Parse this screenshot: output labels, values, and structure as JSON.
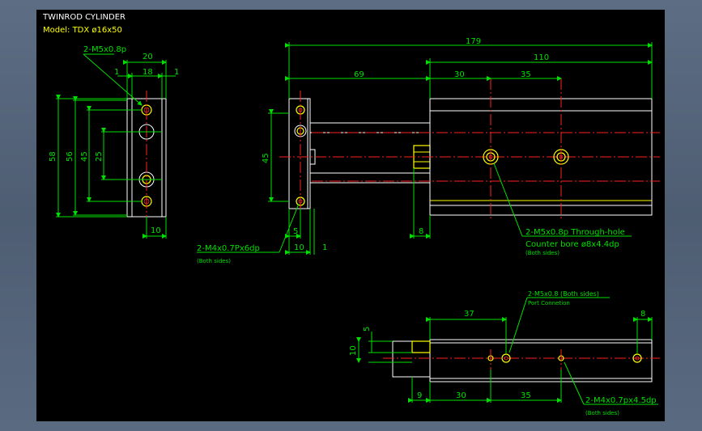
{
  "title": "TWINROD CYLINDER",
  "model": "Model: TDX ø16x50",
  "colors": {
    "outline": "#ffffff",
    "dimension": "#00e000",
    "hidden": "#ffff00",
    "centerline": "#ff2020",
    "background": "#000000"
  },
  "front_view": {
    "callout": "2-M5x0.8p",
    "dims": {
      "width_total": "20",
      "inner_width": "18",
      "edge_left": "1",
      "edge_right": "1",
      "height_total": "58",
      "height_56": "56",
      "height_45": "45",
      "height_25": "25",
      "bottom_10": "10"
    }
  },
  "side_view": {
    "dims": {
      "total": "179",
      "right": "110",
      "left": "69",
      "s30": "30",
      "s35": "35",
      "h45": "45",
      "d5": "5",
      "d10": "10",
      "d1": "1",
      "d8": "8"
    },
    "note1_line1": "2-M5x0.8p Through-hole",
    "note1_line2": "Counter bore ø8x4.4dp",
    "note1_sub": "(Both sides)",
    "note2": "2-M4x0.7Px6dp",
    "note2_sub": "(Both sides)"
  },
  "bottom_view": {
    "dims": {
      "d37": "37",
      "d8": "8",
      "d5": "5",
      "d10": "10",
      "d9": "9",
      "d30": "30",
      "d35": "35"
    },
    "note_port": "2-M5x0.8 (Both sides)",
    "note_port_sub": "Port Connetion",
    "note_m4": "2-M4x0.7px4.5dp",
    "note_m4_sub": "(Both sides)"
  }
}
